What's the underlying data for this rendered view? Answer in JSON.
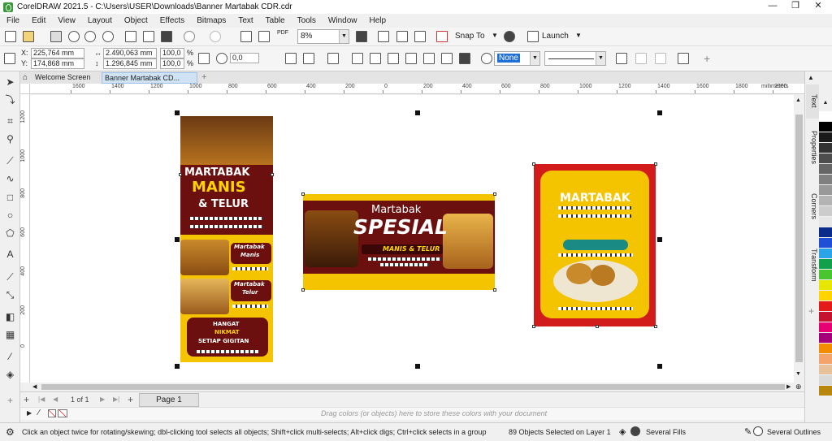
{
  "window": {
    "title": "CorelDRAW 2021.5 - C:\\Users\\USER\\Downloads\\Banner Martabak CDR.cdr",
    "minimize": "—",
    "restore": "❐",
    "close": "✕"
  },
  "menu": [
    "File",
    "Edit",
    "View",
    "Layout",
    "Object",
    "Effects",
    "Bitmaps",
    "Text",
    "Table",
    "Tools",
    "Window",
    "Help"
  ],
  "toolbar": {
    "zoom_value": "8%",
    "snap_to": "Snap To",
    "launch": "Launch",
    "pdf_label": "PDF"
  },
  "property_bar": {
    "x_label": "X:",
    "x_value": "225,764 mm",
    "y_label": "Y:",
    "y_value": "174,868 mm",
    "width_value": "2.490,063 mm",
    "height_value": "1.296,845 mm",
    "scale_w": "100,0",
    "scale_h": "100,0",
    "percent": "%",
    "rotation": "0,0",
    "outline_none": "None"
  },
  "tabs": {
    "welcome": "Welcome Screen",
    "document": "Banner Martabak CD...",
    "add": "+"
  },
  "ruler": {
    "units": "millimeters",
    "h_ticks": [
      "1600",
      "1400",
      "1200",
      "1000",
      "800",
      "600",
      "400",
      "200",
      "0",
      "200",
      "400",
      "600",
      "800",
      "1000",
      "1200",
      "1400",
      "1600",
      "1800",
      "2000"
    ],
    "v_ticks": [
      "1200",
      "1000",
      "800",
      "600",
      "400",
      "200",
      "0"
    ]
  },
  "artwork": {
    "vertical_banner": {
      "line1": "MARTABAK",
      "line2": "MANIS",
      "line3": "& TELUR",
      "menu1": "Martabak",
      "menu1b": "Manis",
      "menu2": "Martabak",
      "menu2b": "Telur",
      "tag1": "HANGAT",
      "tag2": "NIKMAT",
      "tag3": "SETIAP GIGITAN"
    },
    "horizontal_banner": {
      "line1": "Martabak",
      "line2": "SPESIAL",
      "line3": "MANIS & TELUR"
    },
    "poster": {
      "line1": "MARTABAK"
    }
  },
  "page_nav": {
    "page_counter": "1 of 1",
    "page_tab": "Page 1"
  },
  "palette_hint": "Drag colors (or objects) here to store these colors with your document",
  "status": {
    "hint": "Click an object twice for rotating/skewing; dbl-clicking tool selects all objects; Shift+click multi-selects; Alt+click digs; Ctrl+click selects in a group",
    "selection": "89 Objects Selected on Layer 1",
    "fill": "Several Fills",
    "outline": "Several Outlines"
  },
  "dockers": [
    "Text",
    "Properties",
    "Corners",
    "Transform"
  ],
  "palette_colors": [
    "#ffffff",
    "#000000",
    "#1a1a1a",
    "#333333",
    "#4d4d4d",
    "#666666",
    "#808080",
    "#999999",
    "#b3b3b3",
    "#cccccc",
    "#e6e6e6",
    "#0b2b8a",
    "#1f4fd6",
    "#2aa3e8",
    "#12a04a",
    "#49c62f",
    "#e6e600",
    "#ffd400",
    "#e51a1a",
    "#c4122f",
    "#e60073",
    "#a3007a",
    "#f28c00",
    "#f4a46a",
    "#e8c09a",
    "#d9d9d9",
    "#b8860b"
  ],
  "colors": {
    "banner_yellow": "#f5c400",
    "banner_maroon": "#6b0f0f",
    "poster_red": "#d21c1c",
    "teal": "#1a8a84"
  }
}
